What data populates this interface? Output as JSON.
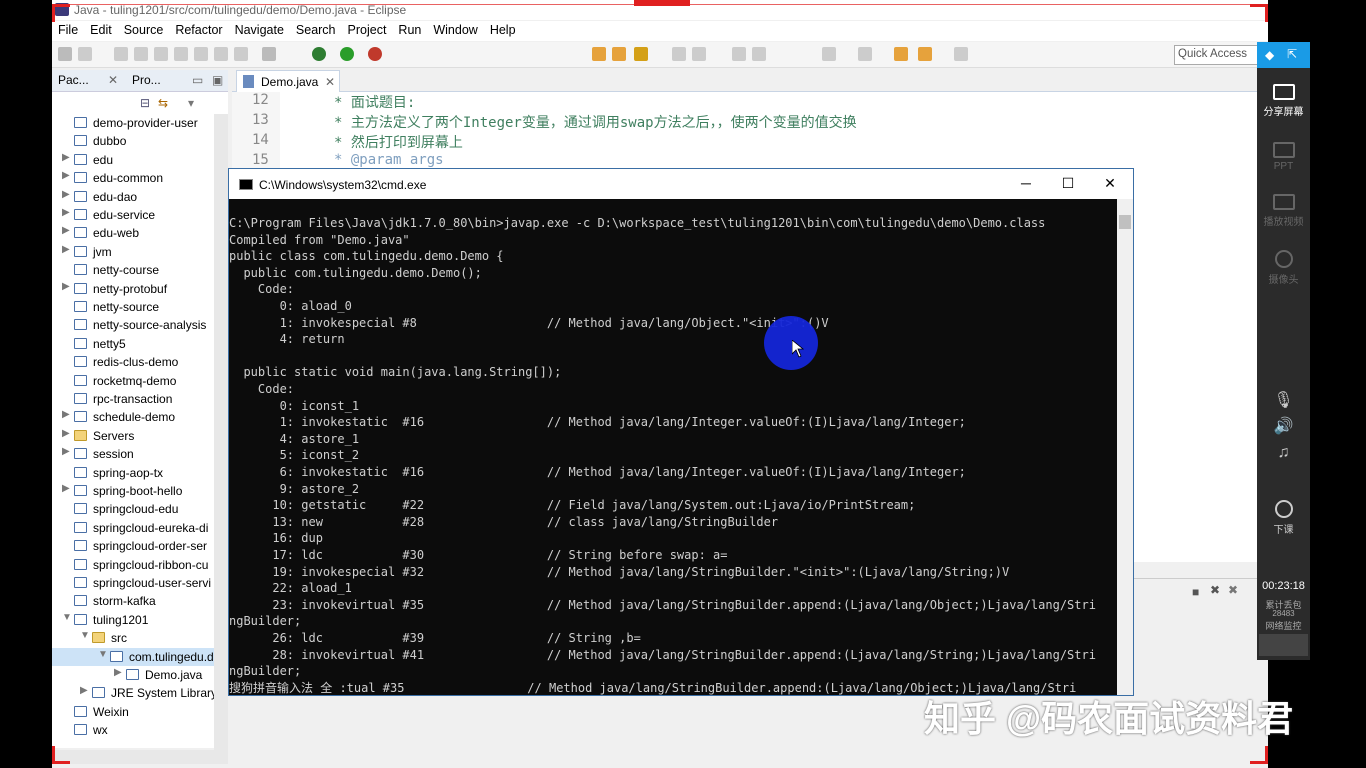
{
  "eclipse": {
    "title": "Java - tuling1201/src/com/tulingedu/demo/Demo.java - Eclipse",
    "menu": [
      "File",
      "Edit",
      "Source",
      "Refactor",
      "Navigate",
      "Search",
      "Project",
      "Run",
      "Window",
      "Help"
    ],
    "quick_access": "Quick Access",
    "left_tabs": [
      "Pac...",
      "Pro..."
    ],
    "tree": [
      {
        "label": "demo-provider-user",
        "arrow": ""
      },
      {
        "label": "dubbo",
        "arrow": ""
      },
      {
        "label": "edu",
        "arrow": ">"
      },
      {
        "label": "edu-common",
        "arrow": ">"
      },
      {
        "label": "edu-dao",
        "arrow": ">"
      },
      {
        "label": "edu-service",
        "arrow": ">"
      },
      {
        "label": "edu-web",
        "arrow": ">"
      },
      {
        "label": "jvm",
        "arrow": ">"
      },
      {
        "label": "netty-course",
        "arrow": ""
      },
      {
        "label": "netty-protobuf",
        "arrow": ">"
      },
      {
        "label": "netty-source",
        "arrow": ""
      },
      {
        "label": "netty-source-analysis",
        "arrow": ""
      },
      {
        "label": "netty5",
        "arrow": ""
      },
      {
        "label": "redis-clus-demo",
        "arrow": ""
      },
      {
        "label": "rocketmq-demo",
        "arrow": ""
      },
      {
        "label": "rpc-transaction",
        "arrow": ""
      },
      {
        "label": "schedule-demo",
        "arrow": ">"
      },
      {
        "label": "Servers",
        "arrow": ">"
      },
      {
        "label": "session",
        "arrow": ">"
      },
      {
        "label": "spring-aop-tx",
        "arrow": ""
      },
      {
        "label": "spring-boot-hello",
        "arrow": ">"
      },
      {
        "label": "springcloud-edu",
        "arrow": ""
      },
      {
        "label": "springcloud-eureka-di",
        "arrow": ""
      },
      {
        "label": "springcloud-order-ser",
        "arrow": ""
      },
      {
        "label": "springcloud-ribbon-cu",
        "arrow": ""
      },
      {
        "label": "springcloud-user-servi",
        "arrow": ""
      },
      {
        "label": "storm-kafka",
        "arrow": ""
      },
      {
        "label": "tuling1201",
        "arrow": "v"
      },
      {
        "label": "src",
        "arrow": "v"
      },
      {
        "label": "com.tulingedu.d",
        "arrow": "v"
      },
      {
        "label": "Demo.java",
        "arrow": ">"
      },
      {
        "label": "JRE System Library",
        "arrow": ">"
      },
      {
        "label": "Weixin",
        "arrow": ""
      },
      {
        "label": "wx",
        "arrow": ""
      }
    ],
    "editor_tab": "Demo.java",
    "code": [
      {
        "ln": "12",
        "text": "*  面试题目:"
      },
      {
        "ln": "13",
        "text": "*  主方法定义了两个Integer变量，通过调用swap方法之后，，使两个变量的值交换"
      },
      {
        "ln": "14",
        "text": "*  然后打印到屏幕上"
      },
      {
        "ln": "15",
        "text": "*  @param args"
      }
    ]
  },
  "cmd": {
    "title": "C:\\Windows\\system32\\cmd.exe",
    "lines": [
      "C:\\Program Files\\Java\\jdk1.7.0_80\\bin>javap.exe -c D:\\workspace_test\\tuling1201\\bin\\com\\tulingedu\\demo\\Demo.class",
      "Compiled from \"Demo.java\"",
      "public class com.tulingedu.demo.Demo {",
      "  public com.tulingedu.demo.Demo();",
      "    Code:",
      "       0: aload_0",
      "       1: invokespecial #8                  // Method java/lang/Object.\"<init>\":()V",
      "       4: return",
      "",
      "  public static void main(java.lang.String[]);",
      "    Code:",
      "       0: iconst_1",
      "       1: invokestatic  #16                 // Method java/lang/Integer.valueOf:(I)Ljava/lang/Integer;",
      "       4: astore_1",
      "       5: iconst_2",
      "       6: invokestatic  #16                 // Method java/lang/Integer.valueOf:(I)Ljava/lang/Integer;",
      "       9: astore_2",
      "      10: getstatic     #22                 // Field java/lang/System.out:Ljava/io/PrintStream;",
      "      13: new           #28                 // class java/lang/StringBuilder",
      "      16: dup",
      "      17: ldc           #30                 // String before swap: a=",
      "      19: invokespecial #32                 // Method java/lang/StringBuilder.\"<init>\":(Ljava/lang/String;)V",
      "      22: aload_1",
      "      23: invokevirtual #35                 // Method java/lang/StringBuilder.append:(Ljava/lang/Object;)Ljava/lang/Stri",
      "ngBuilder;",
      "      26: ldc           #39                 // String ,b=",
      "      28: invokevirtual #41                 // Method java/lang/StringBuilder.append:(Ljava/lang/String;)Ljava/lang/Stri",
      "ngBuilder;",
      "搜狗拼音输入法 全 :tual #35                 // Method java/lang/StringBuilder.append:(Ljava/lang/Object;)Ljava/lang/Stri"
    ]
  },
  "side_panel": {
    "share": "分享屏幕",
    "ppt": "PPT",
    "video": "播放视频",
    "camera": "摄像头",
    "end_class": "下课",
    "timer": "00:23:18",
    "stat1": "累计丢包",
    "stat2": "28483",
    "stat3": "网络监控"
  },
  "watermark": "知乎 @码农面试资料君",
  "colors": {
    "cmd_bg": "#0c0c0c",
    "cmd_text": "#cfcfcf",
    "comment": "#3f7f5f",
    "record_frame": "#e02020",
    "cursor_highlight": "#1426d8"
  }
}
